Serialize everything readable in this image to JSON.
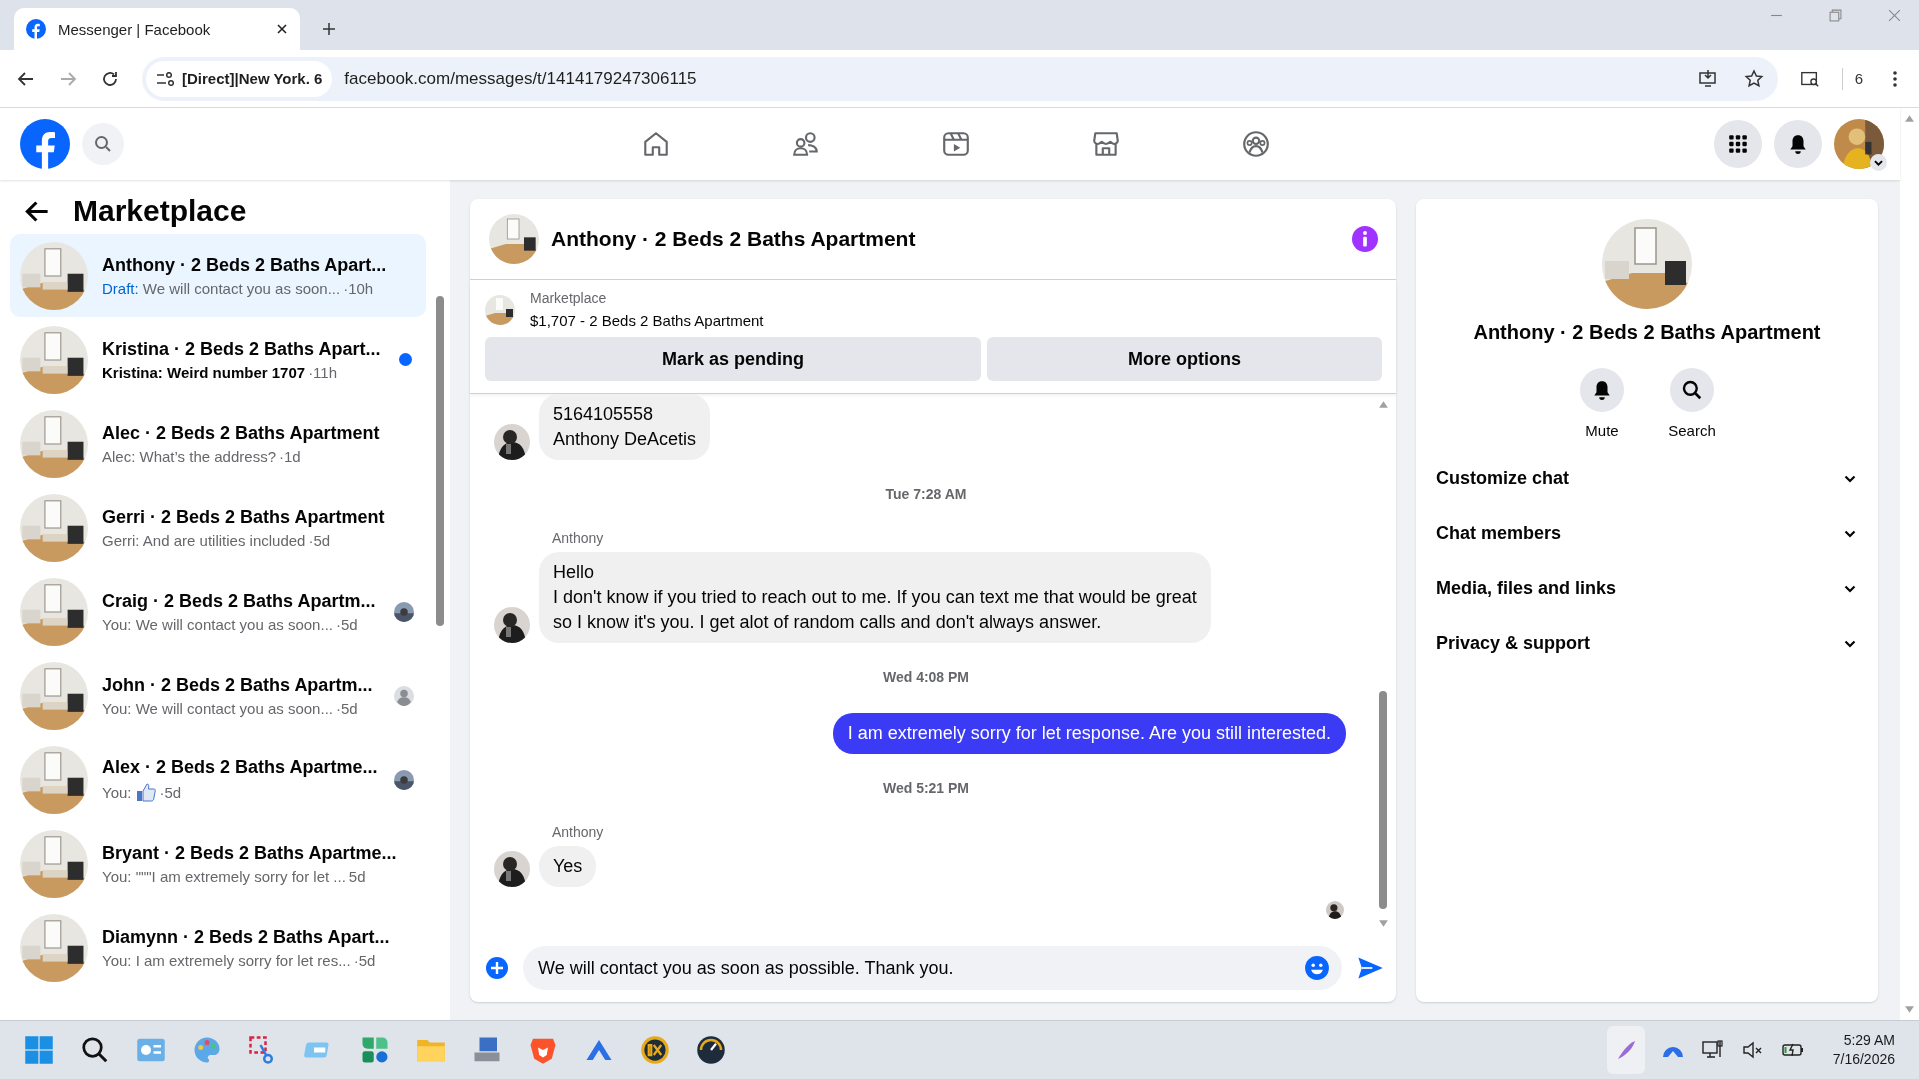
{
  "browser": {
    "tab_title": "Messenger | Facebook",
    "url_site": "[Direct]|New York. 6",
    "url": "facebook.com/messages/t/1414179247306115",
    "extensions_count": "6"
  },
  "sidebar": {
    "title": "Marketplace",
    "conversations": [
      {
        "name": "Anthony · 2 Beds 2 Baths Apart...",
        "prefix": "Draft:",
        "preview": "We will contact you as soon...",
        "time": "·10h",
        "unread": false,
        "selected": true
      },
      {
        "name": "Kristina · 2 Beds 2 Baths Apart...",
        "preview": "Kristina: Weird number 1707",
        "time": "·11h",
        "unread": true,
        "selected": false,
        "receipt": {
          "kind": "unread"
        }
      },
      {
        "name": "Alec · 2 Beds 2 Baths Apartment",
        "preview": "Alec: What’s the address?",
        "time": "·1d",
        "unread": false,
        "selected": false
      },
      {
        "name": "Gerri · 2 Beds 2 Baths Apartment",
        "preview": "Gerri: And are utilities included",
        "time": "·5d",
        "unread": false,
        "selected": false
      },
      {
        "name": "Craig · 2 Beds 2 Baths Apartm...",
        "preview": "You: We will contact you as soon...",
        "time": "·5d",
        "unread": false,
        "selected": false
      },
      {
        "name": "John · 2 Beds 2 Baths Apartm...",
        "preview": "You: We will contact you as soon...",
        "time": "·5d",
        "unread": false,
        "selected": false,
        "receipt": {
          "kind": "default"
        }
      },
      {
        "name": "Alex · 2 Beds 2 Baths Apartme...",
        "preview": "You:",
        "like": true,
        "time": "·5d",
        "unread": false,
        "selected": false
      },
      {
        "name": "Bryant · 2 Beds 2 Baths Apartme...",
        "preview": "You: \"\"\"I am extremely sorry for let ...",
        "time": "5d",
        "unread": false,
        "selected": false
      },
      {
        "name": "Diamynn · 2 Beds 2 Baths Apart...",
        "preview": "You: I am extremely sorry for let res...",
        "time": "·5d",
        "unread": false,
        "selected": false
      }
    ]
  },
  "chat": {
    "title": "Anthony · 2 Beds 2 Baths Apartment",
    "listing": {
      "label": "Marketplace",
      "title": "$1,707 - 2 Beds 2 Baths Apartment"
    },
    "actions": [
      "Mark as pending",
      "More options"
    ],
    "messages": [
      {
        "kind": "incoming",
        "lines": [
          "5164105558",
          "Anthony DeAcetis"
        ]
      },
      {
        "kind": "time",
        "text": "Tue 7:28 AM"
      },
      {
        "kind": "incoming",
        "sender": "Anthony",
        "lines": [
          "Hello",
          "I don't know if you tried to reach out to me. If you can text me that would be great",
          "so I know it's you. I get alot of random calls and don't always answer."
        ]
      },
      {
        "kind": "time",
        "text": "Wed 4:08 PM"
      },
      {
        "kind": "outgoing",
        "lines": [
          "I am extremely sorry for let response. Are you still interested."
        ]
      },
      {
        "kind": "time",
        "text": "Wed 5:21 PM"
      },
      {
        "kind": "incoming",
        "sender": "Anthony",
        "lines": [
          "Yes"
        ]
      },
      {
        "kind": "seen"
      }
    ],
    "composer": {
      "value": "We will contact you as soon as possible. Thank you."
    }
  },
  "details": {
    "title": "Anthony · 2 Beds 2 Baths Apartment",
    "actions": [
      {
        "label": "Mute",
        "kind": "bell"
      },
      {
        "label": "Search",
        "kind": "search"
      }
    ],
    "sections": [
      "Customize chat",
      "Chat members",
      "Media, files and links",
      "Privacy & support"
    ]
  },
  "taskbar": {
    "time": "5:29 AM",
    "date": "7/16/2026"
  }
}
